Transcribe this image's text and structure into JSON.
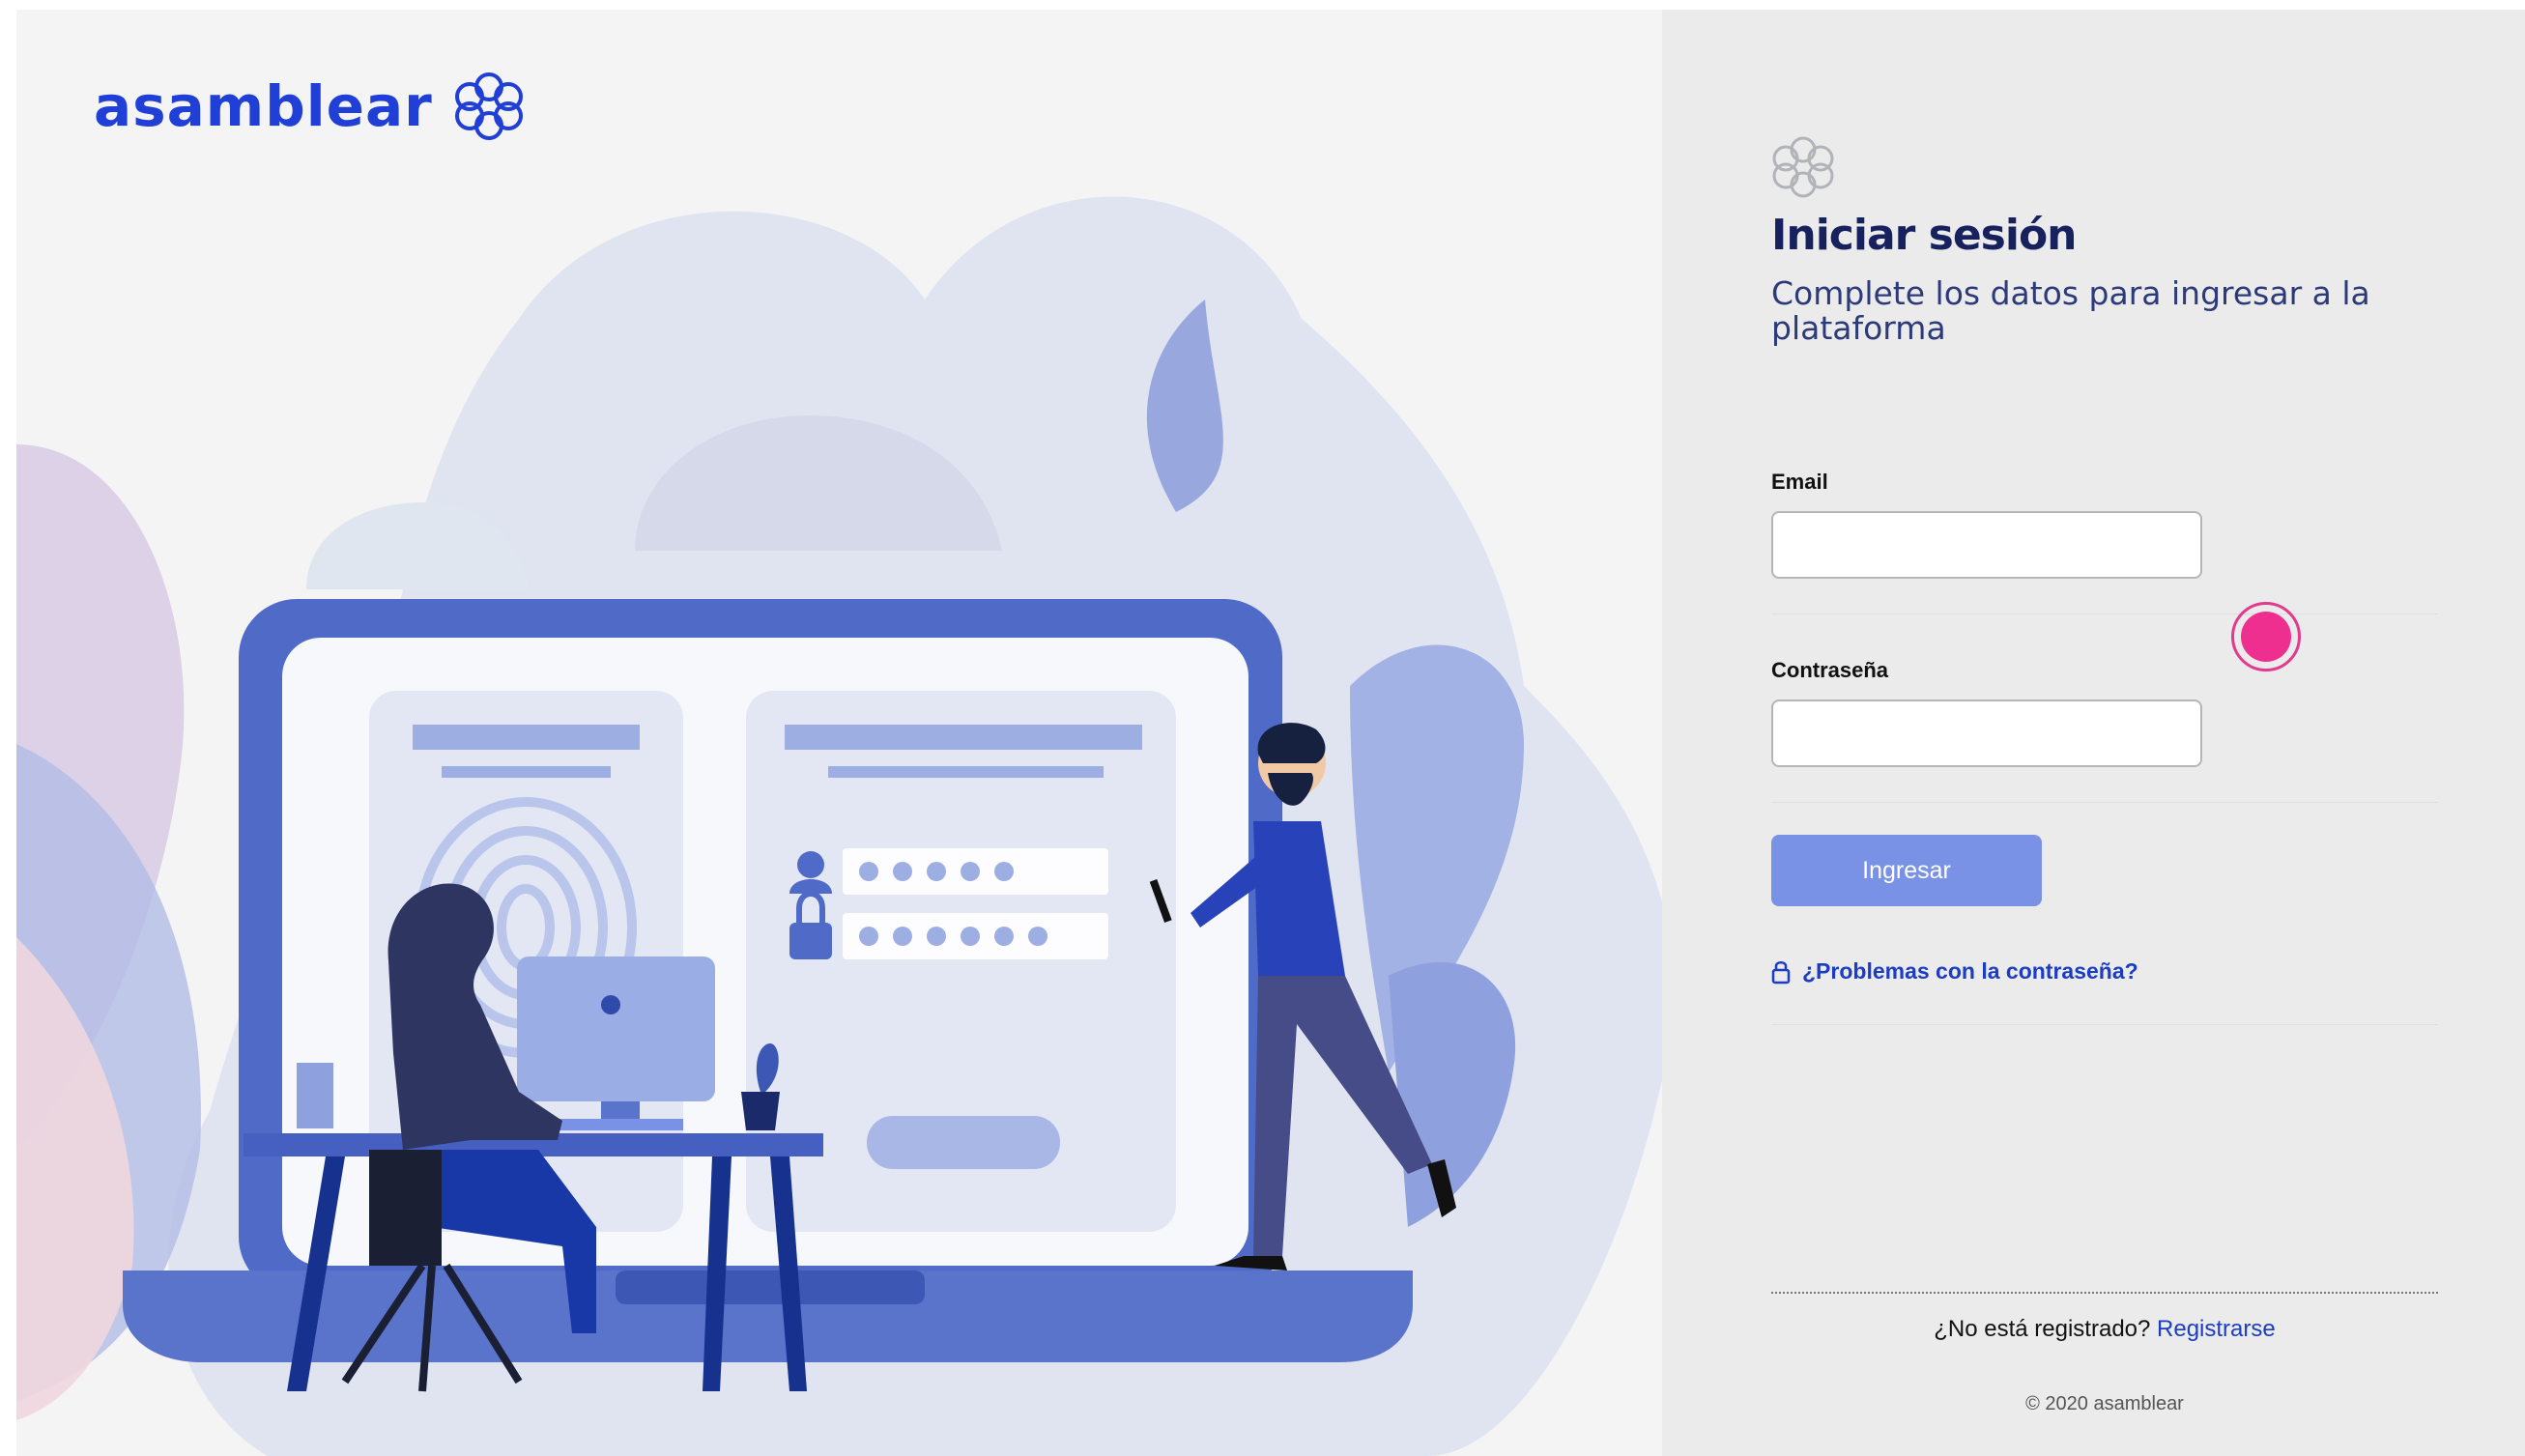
{
  "brand": {
    "name": "asamblear",
    "color": "#1f3fd6"
  },
  "login": {
    "title": "Iniciar sesión",
    "subtitle": "Complete los datos para ingresar a la plataforma",
    "email_label": "Email",
    "email_value": "",
    "password_label": "Contraseña",
    "password_value": "",
    "submit_label": "Ingresar",
    "forgot_label": "¿Problemas con la contraseña?",
    "register_prompt": "¿No está registrado?",
    "register_link": "Registrarse",
    "copyright": "© 2020 asamblear"
  },
  "icons": {
    "logo": "flower-logo-icon",
    "form_logo": "flower-logo-icon",
    "forgot": "lock-icon"
  },
  "colors": {
    "accent": "#1f3fd6",
    "button": "#7a92e6",
    "title": "#16215e",
    "cursor": "#ee2f8f"
  }
}
